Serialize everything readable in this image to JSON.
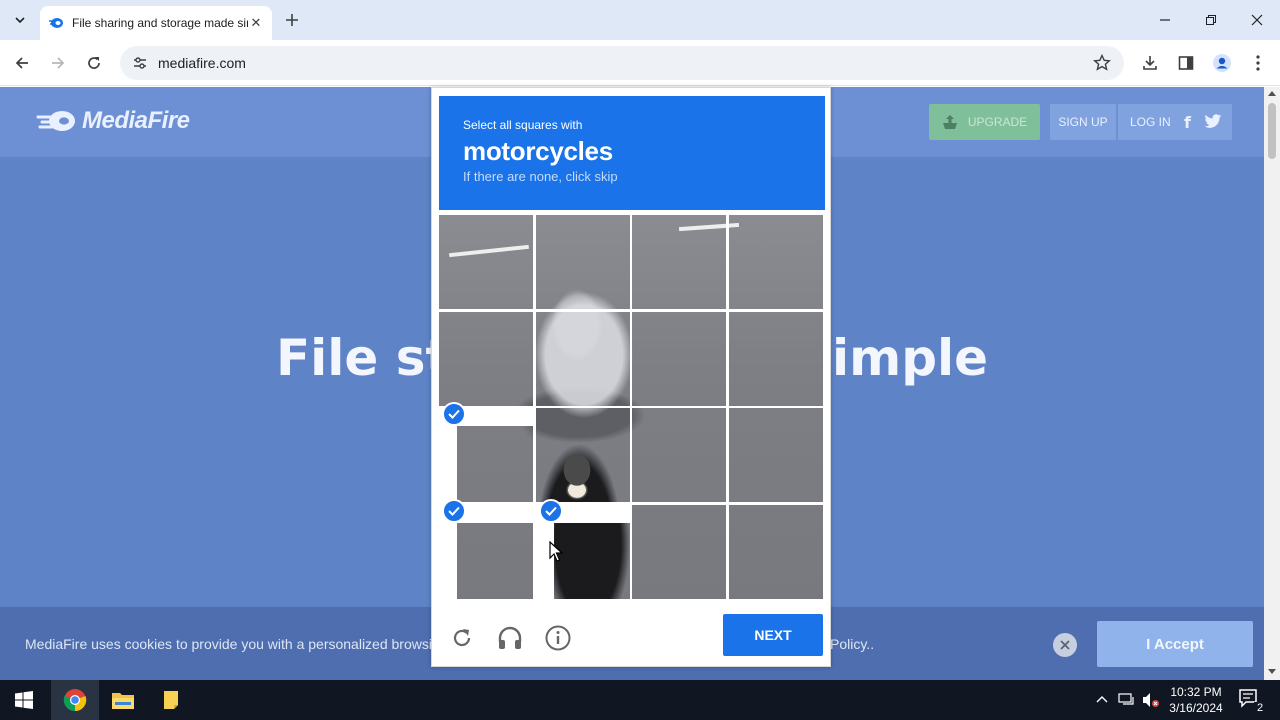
{
  "browser": {
    "tab_title": "File sharing and storage made simple",
    "url": "mediafire.com"
  },
  "site": {
    "logo_text": "MediaFire",
    "upgrade_label": "UPGRADE",
    "signup_label": "SIGN UP",
    "login_label": "LOG IN",
    "facebook_glyph": "f",
    "hero_text": "File storage made simple",
    "cookie_text": "MediaFire uses cookies to provide you with a personalized browsing",
    "cookie_text_end": "Policy..",
    "accept_label": "I Accept"
  },
  "captcha": {
    "instruction": "Select all squares with",
    "target": "motorcycles",
    "hint": "If there are none, click skip",
    "selected_tiles": [
      8,
      12,
      13
    ],
    "next_label": "NEXT"
  },
  "taskbar": {
    "time": "10:32 PM",
    "date": "3/16/2024",
    "notification_count": "2"
  },
  "colors": {
    "accent": "#1a73e8",
    "page_overlay": "#5e83c6"
  }
}
